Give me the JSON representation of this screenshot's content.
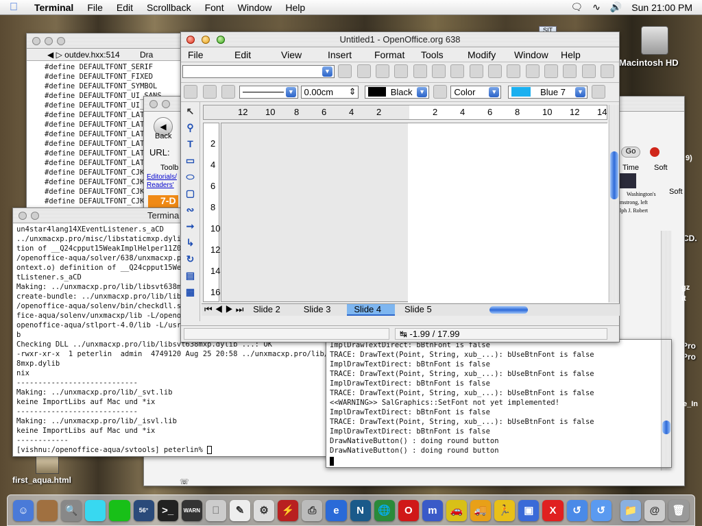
{
  "menubar": {
    "app": "Terminal",
    "items": [
      "File",
      "Edit",
      "Scrollback",
      "Font",
      "Window",
      "Help"
    ],
    "clock": "Sun 21:00 PM"
  },
  "desktop": {
    "hd_label": "Macintosh HD",
    "file_label": "first_aqua.html",
    "cd_label": "CD.",
    "pro_labels": [
      "Pro",
      "Pro"
    ],
    "sit_label": "SIT"
  },
  "editor_window": {
    "title": "outdev.hxx:514",
    "tail": "Dra",
    "lines": [
      "#define DEFAULTFONT_SERIF",
      "#define DEFAULTFONT_FIXED",
      "#define DEFAULTFONT_SYMBOL",
      "#define DEFAULTFONT_UI_SANS",
      "#define DEFAULTFONT_UI_F",
      "#define DEFAULTFONT_LATI",
      "#define DEFAULTFONT_LATI",
      "#define DEFAULTFONT_LATI",
      "#define DEFAULTFONT_LATI",
      "#define DEFAULTFONT_LATI",
      "#define DEFAULTFONT_LATI",
      "#define DEFAULTFONT_CJK_",
      "#define DEFAULTFONT_CJK_",
      "#define DEFAULTFONT_CJK_",
      "#define DEFAULTFONT_CJK_"
    ]
  },
  "browser_window": {
    "back": "Back",
    "url_label": "URL:",
    "toolbar_tab": "Toolb",
    "links": [
      "Editorials/",
      "Readers'"
    ],
    "badge": "7-D",
    "go": "Go",
    "time_tab": "Time",
    "soft_tab": "Soft",
    "soft2": "Soft",
    "num": "9)",
    "news": [
      "Washington's",
      "mstrong, left",
      "lph J. Robert"
    ],
    "side_labels": [
      "gz",
      "it",
      "e_In"
    ]
  },
  "term_left": {
    "title": "Termina",
    "lines": [
      "un4star4lang14XEventListener.s_aCD",
      "../unxmacxp.pro/misc/libstaticmxp.dylib(",
      "tion of __Q24cpput15WeakImplHelper11Z053",
      "/openoffice-aqua/solver/638/unxmacxp.pro",
      "ontext.o) definition of __Q24cpput15Weak",
      "tListener.s_aCD",
      "Making: ../unxmacxp.pro/lib/libsvt638mxp",
      "create-bundle: ../unxmacxp.pro/lib/libsv",
      "/openoffice-aqua/solenv/bin/checkdll.sh",
      "fice-aqua/solenv/unxmacxp/lib -L/openoff",
      "openoffice-aqua/stlport-4.0/lib -L/usr/l",
      "b",
      "Checking DLL ../unxmacxp.pro/lib/libsvt638mxp.dylib ...: OK",
      "-rwxr-xr-x  1 peterlin  admin  4749120 Aug 25 20:58 ../unxmacxp.pro/lib/lib",
      "8mxp.dylib",
      "nix",
      "----------------------------",
      "Making: ../unxmacxp.pro/lib/_svt.lib",
      "keine ImportLibs auf Mac und *ix",
      "----------------------------",
      "Making: ../unxmacxp.pro/lib/_isvl.lib",
      "keine ImportLibs auf Mac und *ix",
      "------------",
      "[vishnu:/openoffice-aqua/svtools] peterlin% "
    ]
  },
  "term_right": {
    "lines": [
      "ImplDrawTextDirect: bBtnFont is false",
      "TRACE: DrawText(Point, String, xub_...): bUseBtnFont is false",
      "ImplDrawTextDirect: bBtnFont is false",
      "TRACE: DrawText(Point, String, xub_...): bUseBtnFont is false",
      "ImplDrawTextDirect: bBtnFont is false",
      "TRACE: DrawText(Point, String, xub_...): bUseBtnFont is false",
      "<<WARNING>> SalGraphics::SetFont not yet implemented!",
      "ImplDrawTextDirect: bBtnFont is false",
      "TRACE: DrawText(Point, String, xub_...): bUseBtnFont is false",
      "ImplDrawTextDirect: bBtnFont is false",
      "DrawNativeButton() : doing round button",
      "DrawNativeButton() : doing round button"
    ]
  },
  "oo_window": {
    "title": "Untitled1 - OpenOffice.org 638",
    "menu": [
      "File",
      "Edit",
      "View",
      "Insert",
      "Format",
      "Tools",
      "Modify",
      "Window",
      "Help"
    ],
    "line_width": "0.00cm",
    "line_color": "Black",
    "fill_type": "Color",
    "fill_color": "Blue 7",
    "ruler_h": [
      "12",
      "10",
      "8",
      "6",
      "4",
      "2",
      "2",
      "4",
      "6",
      "8",
      "10",
      "12",
      "14"
    ],
    "ruler_v": [
      "2",
      "4",
      "6",
      "8",
      "10",
      "12",
      "14",
      "16"
    ],
    "slides": [
      "Slide 2",
      "Slide 3",
      "Slide 4",
      "Slide 5"
    ],
    "active_slide": "Slide 4",
    "position": "-1.99 / 17.99"
  }
}
